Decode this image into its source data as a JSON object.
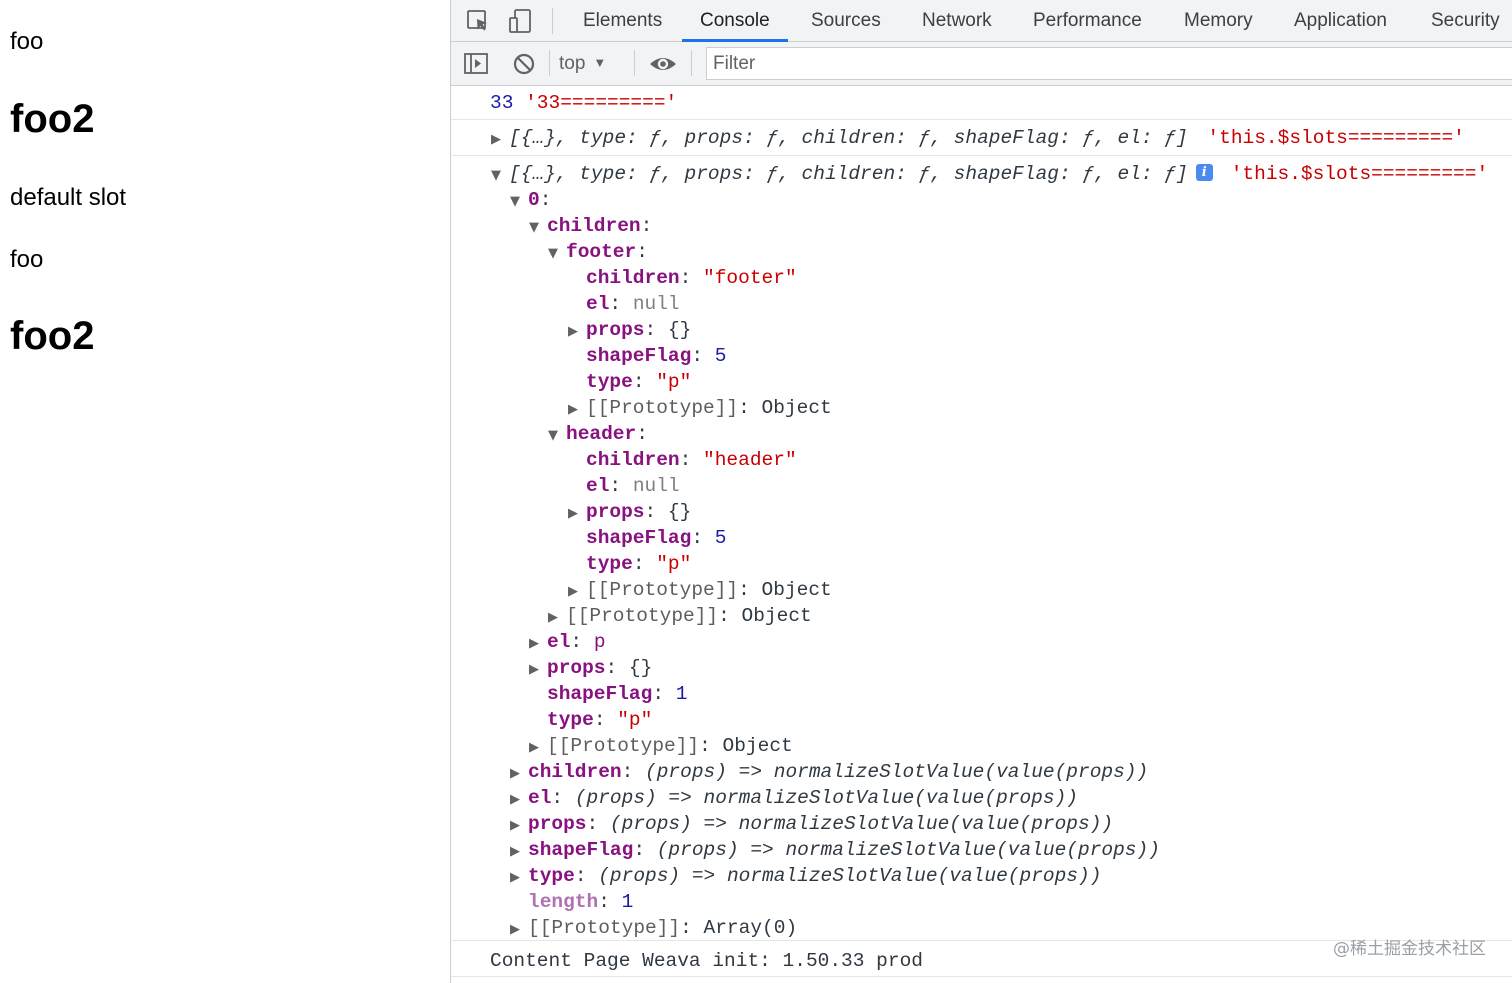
{
  "page": {
    "lines": [
      "foo",
      "foo2",
      "default slot",
      "foo",
      "foo2"
    ]
  },
  "devtools": {
    "tabs": [
      "Elements",
      "Console",
      "Sources",
      "Network",
      "Performance",
      "Memory",
      "Application",
      "Security"
    ],
    "active_tab": "Console",
    "toolbar": {
      "context": "top",
      "filter_placeholder": "Filter"
    },
    "messages": {
      "m1": {
        "num": "33",
        "str": "'33========='"
      },
      "m2": {
        "summary": "[{…}, type: ƒ, props: ƒ, children: ƒ, shapeFlag: ƒ, el: ƒ]",
        "str": "'this.$slots========='"
      },
      "m3": {
        "summary": "[{…}, type: ƒ, props: ƒ, children: ƒ, shapeFlag: ƒ, el: ƒ]",
        "info": "i",
        "str": "'this.$slots========='"
      },
      "tree": {
        "index0": "0",
        "children": "children",
        "footer": "footer",
        "footer_children_key": "children",
        "footer_children_val": "\"footer\"",
        "footer_el_key": "el",
        "footer_el_val": "null",
        "footer_props_key": "props",
        "footer_props_val": "{}",
        "footer_shapeFlag_key": "shapeFlag",
        "footer_shapeFlag_val": "5",
        "footer_type_key": "type",
        "footer_type_val": "\"p\"",
        "footer_proto": "[[Prototype]]",
        "footer_proto_val": "Object",
        "header": "header",
        "header_children_key": "children",
        "header_children_val": "\"header\"",
        "header_el_key": "el",
        "header_el_val": "null",
        "header_props_key": "props",
        "header_props_val": "{}",
        "header_shapeFlag_key": "shapeFlag",
        "header_shapeFlag_val": "5",
        "header_type_key": "type",
        "header_type_val": "\"p\"",
        "header_proto": "[[Prototype]]",
        "header_proto_val": "Object",
        "children_proto": "[[Prototype]]",
        "children_proto_val": "Object",
        "el_key": "el",
        "el_val": "p",
        "props_key": "props",
        "props_val": "{}",
        "shapeFlag_key": "shapeFlag",
        "shapeFlag_val": "1",
        "type_key": "type",
        "type_val": "\"p\"",
        "obj_proto": "[[Prototype]]",
        "obj_proto_val": "Object",
        "fn_children_key": "children",
        "fn_children_val": "(props) => normalizeSlotValue(value(props))",
        "fn_el_key": "el",
        "fn_el_val": "(props) => normalizeSlotValue(value(props))",
        "fn_props_key": "props",
        "fn_props_val": "(props) => normalizeSlotValue(value(props))",
        "fn_shapeFlag_key": "shapeFlag",
        "fn_shapeFlag_val": "(props) => normalizeSlotValue(value(props))",
        "fn_type_key": "type",
        "fn_type_val": "(props) => normalizeSlotValue(value(props))",
        "length_key": "length",
        "length_val": "1",
        "arr_proto": "[[Prototype]]",
        "arr_proto_val": "Array(0)"
      },
      "m4": "Content Page Weava init: 1.50.33 prod"
    }
  },
  "watermark": "@稀土掘金技术社区",
  "colors": {
    "accent": "#1a73e8",
    "key": "#881280",
    "string": "#c80000",
    "number": "#1a1aa6"
  }
}
